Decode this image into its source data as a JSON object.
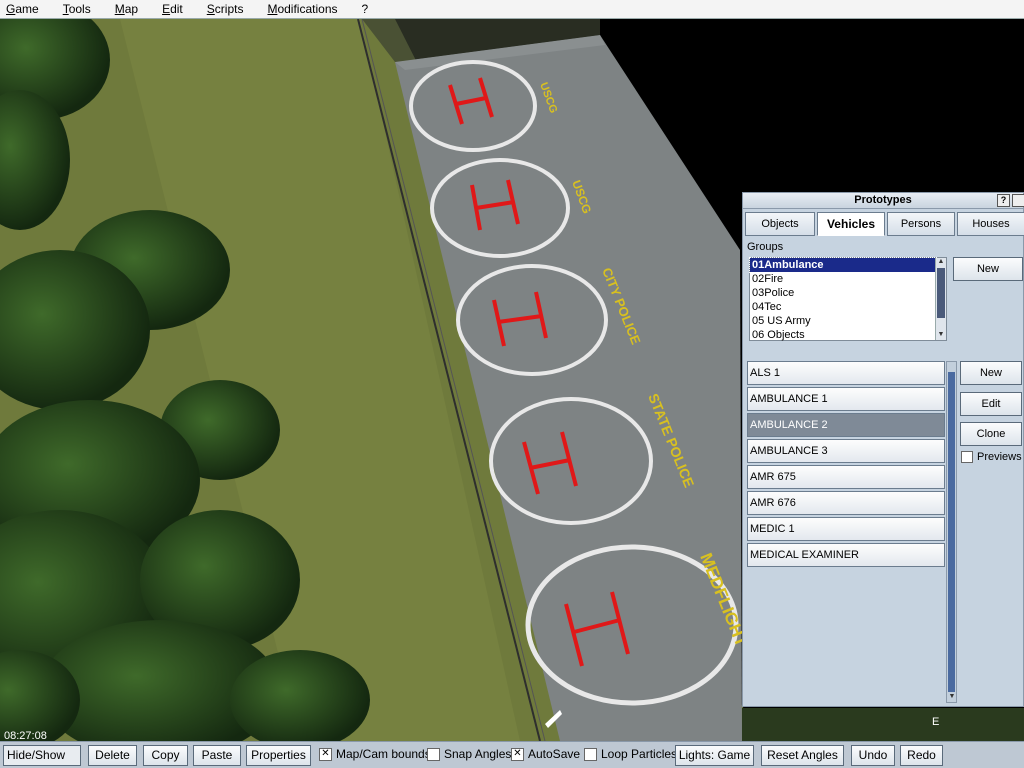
{
  "menu": [
    "Game",
    "Tools",
    "Map",
    "Edit",
    "Scripts",
    "Modifications",
    "?"
  ],
  "scene": {
    "clock": "08:27:08",
    "compass": "E",
    "pad_labels": [
      "USCG",
      "USCG",
      "CITY POLICE",
      "STATE POLICE",
      "MEDFLIGHT"
    ]
  },
  "panel": {
    "title": "Prototypes",
    "help_btn": "?",
    "tabs": [
      "Objects",
      "Vehicles",
      "Persons",
      "Houses"
    ],
    "active_tab": "Vehicles",
    "groups_label": "Groups",
    "groups": [
      "01Ambulance",
      "02Fire",
      "03Police",
      "04Tec",
      "05 US Army",
      "06 Objects"
    ],
    "selected_group": "01Ambulance",
    "group_new_btn": "New",
    "prototypes": [
      "ALS 1",
      "AMBULANCE 1",
      "AMBULANCE 2",
      "AMBULANCE 3",
      "AMR 675",
      "AMR 676",
      "MEDIC 1",
      "MEDICAL EXAMINER"
    ],
    "selected_prototype": "AMBULANCE 2",
    "new_btn": "New",
    "edit_btn": "Edit",
    "clone_btn": "Clone",
    "previews_label": "Previews",
    "previews_checked": false
  },
  "toolbar": {
    "hide_show": "Hide/Show",
    "delete": "Delete",
    "copy": "Copy",
    "paste": "Paste",
    "properties": "Properties",
    "map_cam_bounds": "Map/Cam bounds",
    "map_cam_bounds_checked": true,
    "snap_angles": "Snap Angles",
    "snap_angles_checked": false,
    "autosave": "AutoSave",
    "autosave_checked": true,
    "loop_particles": "Loop Particles",
    "loop_particles_checked": false,
    "lights": "Lights: Game",
    "reset_angles": "Reset Angles",
    "undo": "Undo",
    "redo": "Redo"
  }
}
